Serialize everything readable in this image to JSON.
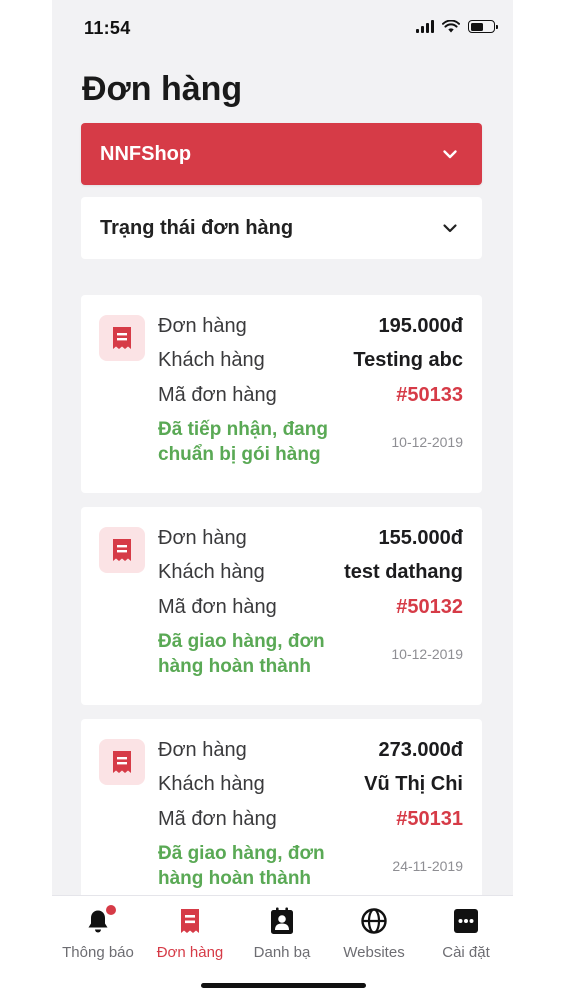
{
  "status_bar": {
    "time": "11:54"
  },
  "page": {
    "title": "Đơn hàng"
  },
  "filters": {
    "shop": {
      "label": "NNFShop"
    },
    "order_status": {
      "label": "Trạng thái đơn hàng"
    }
  },
  "labels": {
    "order": "Đơn hàng",
    "customer": "Khách hàng",
    "order_code": "Mã đơn hàng"
  },
  "orders": [
    {
      "total": "195.000đ",
      "customer": "Testing abc",
      "code": "#50133",
      "state_line1": "Đã tiếp nhận, đang",
      "state_line2": "chuẩn bị gói hàng",
      "date": "10-12-2019"
    },
    {
      "total": "155.000đ",
      "customer": "test dathang",
      "code": "#50132",
      "state_line1": "Đã giao hàng, đơn",
      "state_line2": "hàng hoàn thành",
      "date": "10-12-2019"
    },
    {
      "total": "273.000đ",
      "customer": "Vũ Thị Chi",
      "code": "#50131",
      "state_line1": "Đã giao hàng, đơn",
      "state_line2": "hàng hoàn thành",
      "date": "24-11-2019"
    }
  ],
  "tabbar": {
    "items": [
      {
        "label": "Thông báo",
        "icon": "bell-icon"
      },
      {
        "label": "Đơn hàng",
        "icon": "receipt-icon",
        "active": true
      },
      {
        "label": "Danh bạ",
        "icon": "contacts-icon"
      },
      {
        "label": "Websites",
        "icon": "globe-icon"
      },
      {
        "label": "Cài đặt",
        "icon": "more-icon"
      }
    ]
  },
  "colors": {
    "accent": "#d63b47",
    "status_green": "#5aa955",
    "background": "#f2f2f4"
  }
}
